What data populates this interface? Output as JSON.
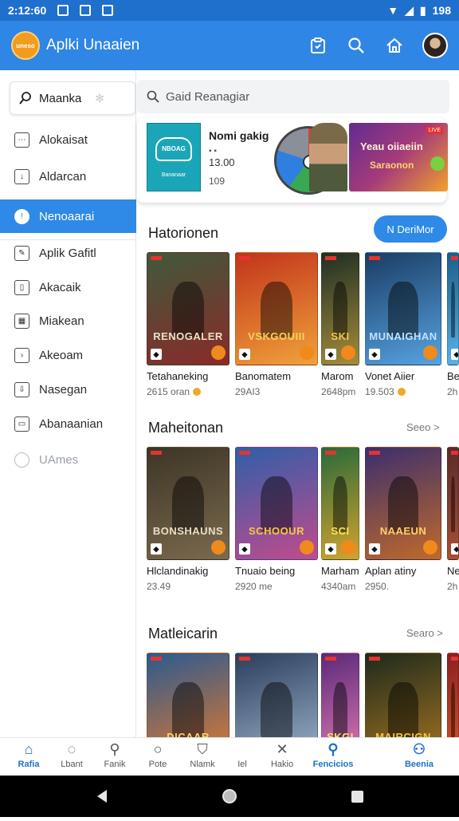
{
  "status": {
    "time": "2:12:60",
    "battery": "198"
  },
  "appbar": {
    "logo_text": "uneso",
    "title": "Aplki Unaaien"
  },
  "sidebar": {
    "search": "Maanka",
    "items": [
      {
        "label": "Alokaisat",
        "icon": "tray-icon"
      },
      {
        "label": "Aldarcan",
        "icon": "download-icon"
      },
      {
        "label": "Nenoaarai",
        "icon": "chat-icon"
      },
      {
        "label": "Aplik Gafitl",
        "icon": "edit-icon"
      },
      {
        "label": "Akacaik",
        "icon": "bookmark-icon"
      },
      {
        "label": "Miakean",
        "icon": "grid-icon"
      },
      {
        "label": "Akeoam",
        "icon": "folder-icon"
      },
      {
        "label": "Nasegan",
        "icon": "download-box-icon"
      },
      {
        "label": "Abanaanian",
        "icon": "archive-icon"
      },
      {
        "label": "UAmes",
        "icon": "settings-icon"
      }
    ]
  },
  "main": {
    "search_placeholder": "Gaid Reanagiar",
    "featured": {
      "thumb_title": "NBOAG",
      "thumb_sub": "Bananaar",
      "name": "Nomi gakig",
      "dots": "▪ ▪",
      "price": "13.00",
      "count": "109",
      "banner_line1": "Yeau oiiaeiin",
      "banner_line2": "Saraonon",
      "banner_tag": "LIVE"
    },
    "section1": {
      "title": "Hatorionen",
      "button": "N DeriMor",
      "items": [
        {
          "name": "Tetahaneking",
          "meta": "2615 oran",
          "coin": true,
          "card_title": "RENOGALER",
          "c1": "#3f5a3a",
          "c2": "#8a2a2a",
          "text_color": "#e8e2c8"
        },
        {
          "name": "Banomatem",
          "meta": "29AI3",
          "coin": false,
          "card_title": "VSKGOUIII",
          "c1": "#c2331c",
          "c2": "#f0a23a",
          "text_color": "#f6d05a"
        },
        {
          "name": "Marom",
          "meta": "2648pm",
          "coin": false,
          "card_title": "SKI",
          "c1": "#1d2f24",
          "c2": "#a78c3b",
          "text_color": "#f2c94c"
        },
        {
          "name": "Vonet Aiier",
          "meta": "19.503",
          "coin": true,
          "card_title": "MUNAIGHAN",
          "c1": "#1b3c63",
          "c2": "#56a3e2",
          "text_color": "#bfe3ff"
        },
        {
          "name": "Be",
          "meta": "2h",
          "coin": false,
          "card_title": "",
          "c1": "#1d5e8a",
          "c2": "#58b2e8",
          "text_color": "#ffffff"
        }
      ]
    },
    "section2": {
      "title": "Maheitonan",
      "more": "Seeo >",
      "items": [
        {
          "name": "Hlclandinakig",
          "meta": "23.49",
          "card_title": "BONSHAUNS",
          "c1": "#3d3526",
          "c2": "#7b6a4e",
          "text_color": "#e9dfc4"
        },
        {
          "name": "Tnuaio being",
          "meta": "2920 me",
          "card_title": "SCHOOUR",
          "c1": "#2e5fa9",
          "c2": "#c34a8c",
          "text_color": "#f7c843"
        },
        {
          "name": "Marham",
          "meta": "4340am",
          "card_title": "SCI",
          "c1": "#2a6a3a",
          "c2": "#d3a32e",
          "text_color": "#ffe25a"
        },
        {
          "name": "Aplan atiny",
          "meta": "2950.",
          "card_title": "NAAEUN",
          "c1": "#3b2e6e",
          "c2": "#c06a2a",
          "text_color": "#ffd166"
        },
        {
          "name": "Ne",
          "meta": "2h",
          "card_title": "",
          "c1": "#5b2a2a",
          "c2": "#a85036",
          "text_color": "#ffffff"
        }
      ]
    },
    "section3": {
      "title": "Matleicarin",
      "more": "Searo >",
      "items": [
        {
          "card_title": "DICAAR",
          "c1": "#2c5a8f",
          "c2": "#e57a2b",
          "text_color": "#ffd36a"
        },
        {
          "card_title": "",
          "c1": "#2b3e5c",
          "c2": "#9fb6cf",
          "text_color": "#ffffff"
        },
        {
          "card_title": "SKGI",
          "c1": "#5a2a7a",
          "c2": "#e77ab5",
          "text_color": "#ffe45c"
        },
        {
          "card_title": "MAIRCIGN",
          "c1": "#1e2a1e",
          "c2": "#a8761f",
          "text_color": "#f5c542"
        },
        {
          "card_title": "",
          "c1": "#8a1f1f",
          "c2": "#d9572a",
          "text_color": "#ffffff"
        }
      ]
    }
  },
  "bottomnav": [
    {
      "label": "Rafia",
      "icon": "home-icon",
      "active": true
    },
    {
      "label": "Lbant",
      "icon": "chat-bubble-icon",
      "active": false
    },
    {
      "label": "Fanik",
      "icon": "search-icon",
      "active": false
    },
    {
      "label": "Pote",
      "icon": "circle-search-icon",
      "active": false
    },
    {
      "label": "Nlamk",
      "icon": "shield-icon",
      "active": false
    },
    {
      "label": "Iel",
      "icon": "none",
      "active": false
    },
    {
      "label": "Hakio",
      "icon": "controller-icon",
      "active": false
    },
    {
      "label": "Fencicios",
      "icon": "notification-search-icon",
      "active": true
    },
    {
      "label": "Beenia",
      "icon": "profile-icon",
      "active": true
    }
  ],
  "colors": {
    "primary": "#2f86e4",
    "statusbar": "#1f6fcc",
    "active": "#2e8ae6",
    "accent_orange": "#f29b1c"
  }
}
